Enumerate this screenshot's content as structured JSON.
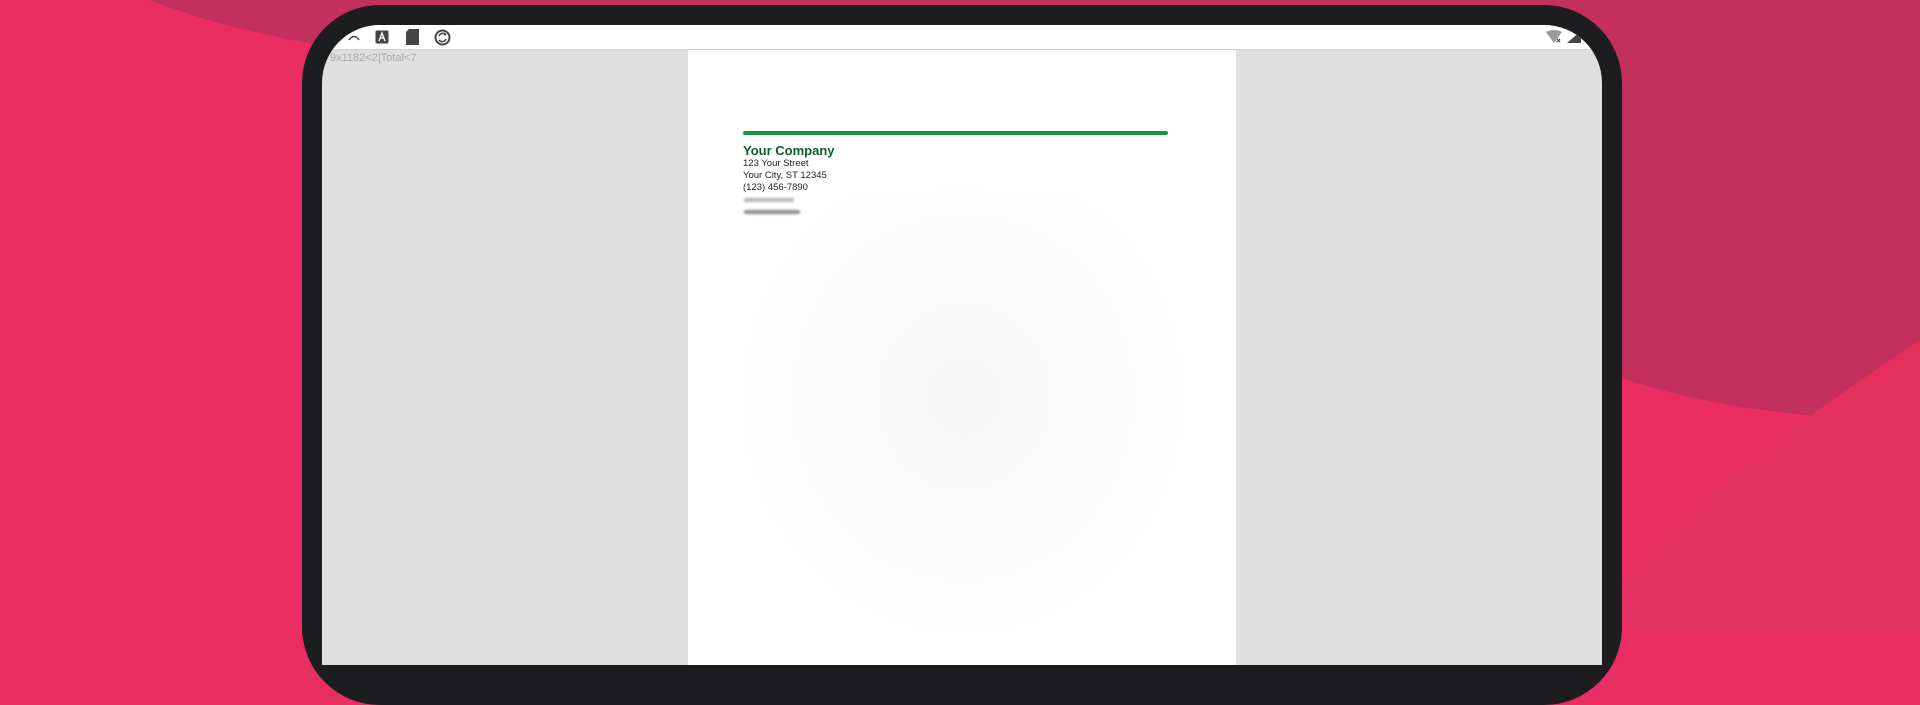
{
  "status_bar": {
    "icons": [
      "signal-icon",
      "text-a-icon",
      "sd-card-icon",
      "sync-icon",
      "wifi-icon",
      "battery-icon"
    ]
  },
  "viewer": {
    "debug_overlay": "9x1182<2|Total<7"
  },
  "document": {
    "company_name": "Your Company",
    "address_line1": "123 Your Street",
    "address_line2": "Your City, ST 12345",
    "phone": "(123) 456-7890"
  },
  "colors": {
    "background_pink": "#ea2e63",
    "background_dark_pink": "#c3305d",
    "device_frame": "#1d1d1f",
    "accent_rule_green": "#0f9a3a",
    "company_name_green": "#0f5d2a",
    "viewer_gray": "#dfdfdf"
  }
}
